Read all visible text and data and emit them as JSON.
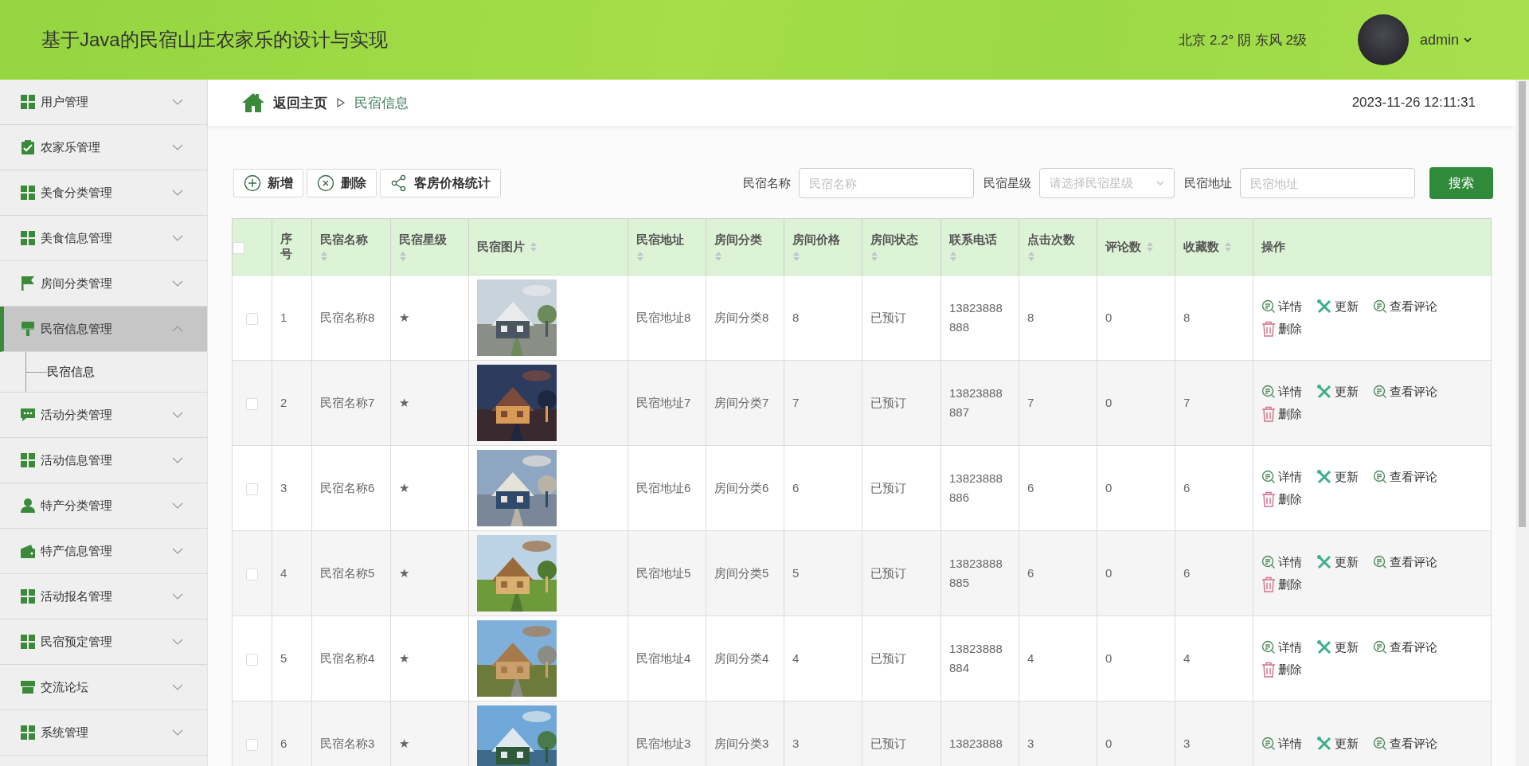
{
  "header": {
    "title": "基于Java的民宿山庄农家乐的设计与实现",
    "weather": "北京 2.2° 阴 东风 2级",
    "user": "admin"
  },
  "sidebar": {
    "items": [
      {
        "label": "用户管理",
        "kind": "grid",
        "expanded": false,
        "selected": false
      },
      {
        "label": "农家乐管理",
        "kind": "clipboard",
        "expanded": false,
        "selected": false
      },
      {
        "label": "美食分类管理",
        "kind": "grid",
        "expanded": false,
        "selected": false
      },
      {
        "label": "美食信息管理",
        "kind": "grid",
        "expanded": false,
        "selected": false
      },
      {
        "label": "房间分类管理",
        "kind": "flag",
        "expanded": false,
        "selected": false
      },
      {
        "label": "民宿信息管理",
        "kind": "brush",
        "expanded": true,
        "selected": true,
        "children": [
          {
            "label": "民宿信息"
          }
        ]
      },
      {
        "label": "活动分类管理",
        "kind": "chat",
        "expanded": false,
        "selected": false
      },
      {
        "label": "活动信息管理",
        "kind": "grid",
        "expanded": false,
        "selected": false
      },
      {
        "label": "特产分类管理",
        "kind": "person",
        "expanded": false,
        "selected": false
      },
      {
        "label": "特产信息管理",
        "kind": "wallet",
        "expanded": false,
        "selected": false
      },
      {
        "label": "活动报名管理",
        "kind": "grid",
        "expanded": false,
        "selected": false
      },
      {
        "label": "民宿预定管理",
        "kind": "grid",
        "expanded": false,
        "selected": false
      },
      {
        "label": "交流论坛",
        "kind": "store",
        "expanded": false,
        "selected": false
      },
      {
        "label": "系统管理",
        "kind": "grid",
        "expanded": false,
        "selected": false
      }
    ]
  },
  "breadcrumb": {
    "home": "返回主页",
    "current": "民宿信息",
    "datetime": "2023-11-26 12:11:31"
  },
  "toolbar": {
    "buttons": [
      {
        "label": "新增",
        "kind": "add"
      },
      {
        "label": "删除",
        "kind": "delete"
      },
      {
        "label": "客房价格统计",
        "kind": "chart"
      }
    ]
  },
  "search": {
    "fields": [
      {
        "label": "民宿名称",
        "placeholder": "民宿名称",
        "kind": "input"
      },
      {
        "label": "民宿星级",
        "placeholder": "请选择民宿星级",
        "kind": "select"
      },
      {
        "label": "民宿地址",
        "placeholder": "民宿地址",
        "kind": "input"
      }
    ],
    "button": "搜索"
  },
  "table": {
    "header_checked": false,
    "columns": [
      {
        "label": "序号",
        "kind": "text",
        "sortable": false
      },
      {
        "label": "民宿名称",
        "kind": "text",
        "sortable": true
      },
      {
        "label": "民宿星级",
        "kind": "text",
        "sortable": true
      },
      {
        "label": "民宿图片",
        "kind": "picture",
        "sortable": true
      },
      {
        "label": "民宿地址",
        "kind": "text",
        "sortable": true
      },
      {
        "label": "房间分类",
        "kind": "text",
        "sortable": true
      },
      {
        "label": "房间价格",
        "kind": "text",
        "sortable": true
      },
      {
        "label": "房间状态",
        "kind": "text",
        "sortable": true
      },
      {
        "label": "联系电话",
        "kind": "text",
        "sortable": true
      },
      {
        "label": "点击次数",
        "kind": "text",
        "sortable": true
      },
      {
        "label": "评论数",
        "kind": "text",
        "sortable": true
      },
      {
        "label": "收藏数",
        "kind": "text",
        "sortable": true
      },
      {
        "label": "操作",
        "kind": "actions",
        "sortable": false
      }
    ],
    "rows": [
      {
        "checked": false,
        "cells": [
          "1",
          "民宿名称8",
          "★",
          {
            "kind": "picture"
          },
          "民宿地址8",
          "房间分类8",
          "8",
          "已预订",
          "13823888888",
          "8",
          "0",
          "8"
        ],
        "actions": [
          {
            "kind": "detail",
            "label": "详情"
          },
          {
            "kind": "update",
            "label": "更新"
          },
          {
            "kind": "comments",
            "label": "查看评论"
          },
          {
            "kind": "delete",
            "label": "删除"
          }
        ]
      },
      {
        "checked": false,
        "cells": [
          "2",
          "民宿名称7",
          "★",
          {
            "kind": "picture"
          },
          "民宿地址7",
          "房间分类7",
          "7",
          "已预订",
          "13823888887",
          "7",
          "0",
          "7"
        ],
        "actions": [
          {
            "kind": "detail",
            "label": "详情"
          },
          {
            "kind": "update",
            "label": "更新"
          },
          {
            "kind": "comments",
            "label": "查看评论"
          },
          {
            "kind": "delete",
            "label": "删除"
          }
        ]
      },
      {
        "checked": false,
        "cells": [
          "3",
          "民宿名称6",
          "★",
          {
            "kind": "picture"
          },
          "民宿地址6",
          "房间分类6",
          "6",
          "已预订",
          "13823888886",
          "6",
          "0",
          "6"
        ],
        "actions": [
          {
            "kind": "detail",
            "label": "详情"
          },
          {
            "kind": "update",
            "label": "更新"
          },
          {
            "kind": "comments",
            "label": "查看评论"
          },
          {
            "kind": "delete",
            "label": "删除"
          }
        ]
      },
      {
        "checked": false,
        "cells": [
          "4",
          "民宿名称5",
          "★",
          {
            "kind": "picture"
          },
          "民宿地址5",
          "房间分类5",
          "5",
          "已预订",
          "13823888885",
          "6",
          "0",
          "6"
        ],
        "actions": [
          {
            "kind": "detail",
            "label": "详情"
          },
          {
            "kind": "update",
            "label": "更新"
          },
          {
            "kind": "comments",
            "label": "查看评论"
          },
          {
            "kind": "delete",
            "label": "删除"
          }
        ]
      },
      {
        "checked": false,
        "cells": [
          "5",
          "民宿名称4",
          "★",
          {
            "kind": "picture"
          },
          "民宿地址4",
          "房间分类4",
          "4",
          "已预订",
          "13823888884",
          "4",
          "0",
          "4"
        ],
        "actions": [
          {
            "kind": "detail",
            "label": "详情"
          },
          {
            "kind": "update",
            "label": "更新"
          },
          {
            "kind": "comments",
            "label": "查看评论"
          },
          {
            "kind": "delete",
            "label": "删除"
          }
        ]
      },
      {
        "checked": false,
        "cells": [
          "6",
          "民宿名称3",
          "★",
          {
            "kind": "picture"
          },
          "民宿地址3",
          "房间分类3",
          "3",
          "已预订",
          "13823888",
          "3",
          "0",
          "3"
        ],
        "actions": [
          {
            "kind": "detail",
            "label": "详情"
          },
          {
            "kind": "update",
            "label": "更新"
          },
          {
            "kind": "comments",
            "label": "查看评论"
          }
        ]
      }
    ]
  }
}
